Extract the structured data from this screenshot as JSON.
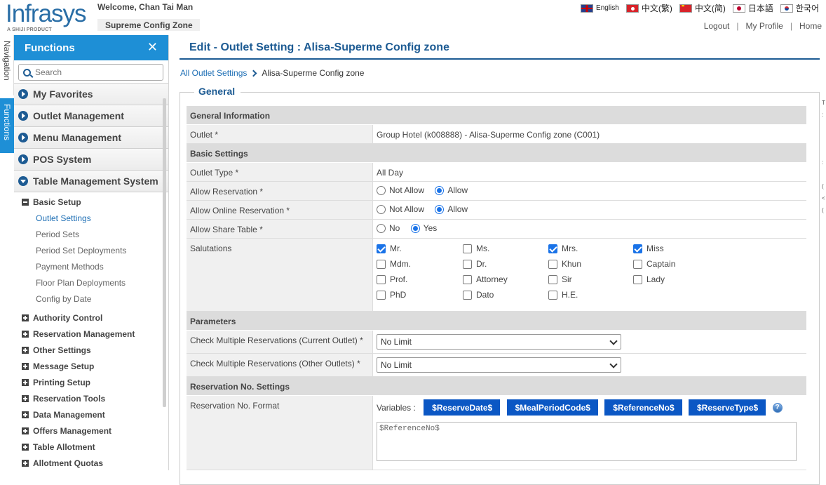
{
  "header": {
    "logo": "Infrasys",
    "logo_sub": "A SHIJI PRODUCT",
    "welcome": "Welcome, Chan Tai Man",
    "zone": "Supreme Config Zone",
    "languages": [
      "English",
      "中文(繁)",
      "中文(简)",
      "日本語",
      "한국어"
    ],
    "links": {
      "logout": "Logout",
      "profile": "My Profile",
      "home": "Home"
    }
  },
  "side_tabs": {
    "navigation": "Navigation",
    "functions": "Functions"
  },
  "sidebar": {
    "title": "Functions",
    "search_placeholder": "Search",
    "main_items": [
      "My Favorites",
      "Outlet Management",
      "Menu Management",
      "POS System",
      "Table Management System"
    ],
    "expanded_group": "Basic Setup",
    "leaves": [
      "Outlet Settings",
      "Period Sets",
      "Period Set Deployments",
      "Payment Methods",
      "Floor Plan Deployments",
      "Config by Date"
    ],
    "groups": [
      "Authority Control",
      "Reservation Management",
      "Other Settings",
      "Message Setup",
      "Printing Setup",
      "Reservation Tools",
      "Data Management",
      "Offers Management",
      "Table Allotment",
      "Allotment Quotas"
    ]
  },
  "page": {
    "title": "Edit - Outlet Setting : Alisa-Superme Config zone",
    "breadcrumb_link": "All Outlet Settings",
    "breadcrumb_current": "Alisa-Superme Config zone",
    "legend": "General"
  },
  "form": {
    "general_info": "General Information",
    "outlet_label": "Outlet *",
    "outlet_value": "Group Hotel (k008888) - Alisa-Superme Config zone (C001)",
    "basic_settings": "Basic Settings",
    "outlet_type_label": "Outlet Type *",
    "outlet_type_value": "All Day",
    "allow_reservation_label": "Allow Reservation *",
    "allow_online_label": "Allow Online Reservation *",
    "allow_share_label": "Allow Share Table *",
    "not_allow": "Not Allow",
    "allow": "Allow",
    "no": "No",
    "yes": "Yes",
    "salutations_label": "Salutations",
    "salutations": [
      "Mr.",
      "Ms.",
      "Mrs.",
      "Miss",
      "Mdm.",
      "Dr.",
      "Khun",
      "Captain",
      "Prof.",
      "Attorney",
      "Sir",
      "Lady",
      "PhD",
      "Dato",
      "H.E."
    ],
    "parameters": "Parameters",
    "check_current_label": "Check Multiple Reservations (Current Outlet) *",
    "check_current_value": "No Limit",
    "check_other_label": "Check Multiple Reservations (Other Outlets) *",
    "check_other_value": "No Limit",
    "res_no_settings": "Reservation No. Settings",
    "res_no_format_label": "Reservation No. Format",
    "variables_label": "Variables :",
    "variables": [
      "$ReserveDate$",
      "$MealPeriodCode$",
      "$ReferenceNo$",
      "$ReserveType$"
    ],
    "help_glyph": "?",
    "format_value": "$ReferenceNo$"
  },
  "colors": {
    "brand": "#1e8fd6",
    "title": "#1d5b93",
    "button": "#0b57c4"
  }
}
